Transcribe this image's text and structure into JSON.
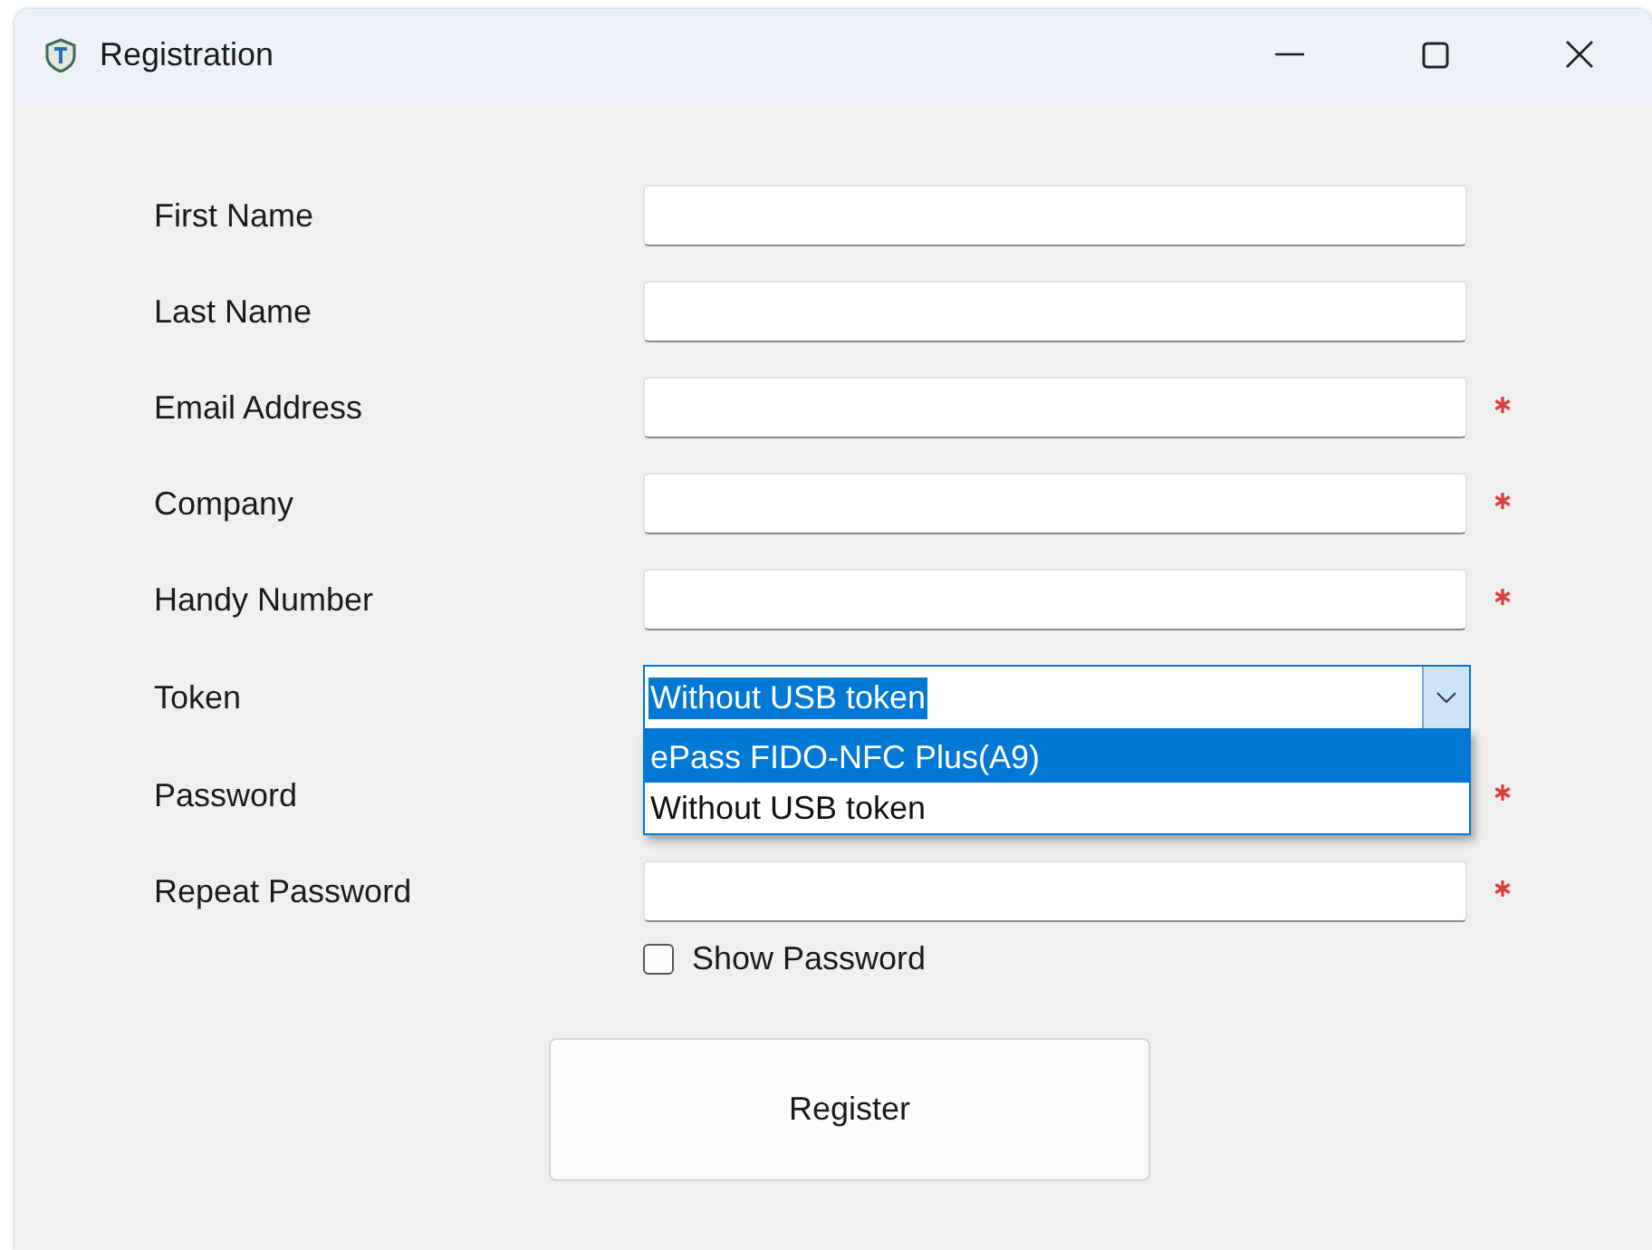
{
  "window": {
    "title": "Registration"
  },
  "rows": [
    {
      "kind": "text",
      "label": "First Name",
      "required": false
    },
    {
      "kind": "text",
      "label": "Last Name",
      "required": false
    },
    {
      "kind": "text",
      "label": "Email Address",
      "required": true
    },
    {
      "kind": "text",
      "label": "Company",
      "required": true
    },
    {
      "kind": "text",
      "label": "Handy Number",
      "required": true
    },
    {
      "kind": "select",
      "label": "Token",
      "required": false,
      "value": "Without USB token",
      "expanded": true,
      "options": [
        {
          "label": "ePass FIDO-NFC Plus(A9)",
          "highlighted": true
        },
        {
          "label": "Without USB token",
          "highlighted": false
        }
      ]
    },
    {
      "kind": "covered",
      "label": "Password",
      "required": true
    },
    {
      "kind": "text",
      "label": "Repeat Password",
      "required": true
    }
  ],
  "show_password": {
    "label": "Show Password",
    "checked": false
  },
  "buttons": [
    "Register"
  ]
}
